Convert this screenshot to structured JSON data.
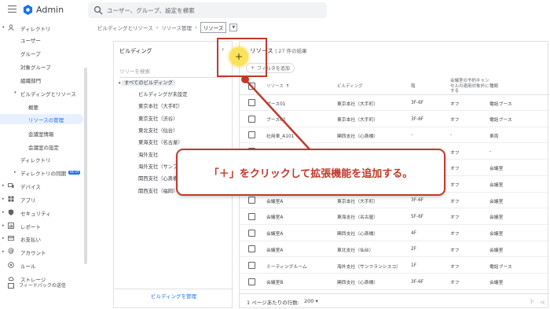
{
  "app": {
    "title": "Admin"
  },
  "search": {
    "placeholder": "ユーザー、グループ、設定を検索"
  },
  "sidebar": {
    "items": [
      {
        "label": "ディレクトリ",
        "icon": "person-icon"
      },
      {
        "label": "ユーザー"
      },
      {
        "label": "グループ"
      },
      {
        "label": "対象グループ"
      },
      {
        "label": "組織部門"
      },
      {
        "label": "ビルディングとリソース"
      },
      {
        "label": "概要"
      },
      {
        "label": "リソースの管理"
      },
      {
        "label": "会議室情報"
      },
      {
        "label": "会議室の設定"
      },
      {
        "label": "ディレクトリ"
      },
      {
        "label": "ディレクトリの同期",
        "badge": "BETA"
      },
      {
        "label": "デバイス",
        "icon": "devices-icon"
      },
      {
        "label": "アプリ",
        "icon": "apps-icon"
      },
      {
        "label": "セキュリティ",
        "icon": "shield-icon"
      },
      {
        "label": "レポート",
        "icon": "bar-chart-icon"
      },
      {
        "label": "お支払い",
        "icon": "credit-card-icon"
      },
      {
        "label": "アカウント",
        "icon": "at-icon"
      },
      {
        "label": "ルール",
        "icon": "rule-icon"
      },
      {
        "label": "ストレージ",
        "icon": "cloud-icon"
      }
    ],
    "feedback": "フィードバックの送信"
  },
  "breadcrumb": {
    "items": [
      "ビルディングとリソース",
      "リソース管理"
    ],
    "current": "リソース"
  },
  "buildings": {
    "title": "ビルディング",
    "search_placeholder": "ツリーを検索",
    "root": "すべてのビルディング",
    "items": [
      "ビルディングが未設定",
      "東京本社（大手町）",
      "東京支社（渋谷）",
      "東北支社（仙台）",
      "東海支社（名古屋）",
      "海外支社",
      "海外支社（サンフ",
      "関西支社（心斎橋",
      "関西支社（福岡）"
    ],
    "manage_link": "ビルディングを管理"
  },
  "resources": {
    "title": "リソース",
    "count": "27 件の結果",
    "filter_label": "フィルタを追加",
    "columns": [
      "リソース",
      "ビルディング",
      "階",
      "会議室の予約キャンセルの適用対象外にする",
      "種類"
    ],
    "rows": [
      [
        "ブース01",
        "東京本社（大手町）",
        "3F-6F",
        "オフ",
        "電話ブース"
      ],
      [
        "ブース02",
        "東京本社（大手町）",
        "3F-6F",
        "オフ",
        "電話ブース"
      ],
      [
        "社用車_A101",
        "関西支社（心斎橋）",
        "-",
        "-",
        "車両"
      ],
      [
        "",
        "",
        "",
        "オフ",
        "-"
      ],
      [
        "",
        "",
        "",
        "オフ",
        "会議室"
      ],
      [
        "",
        "",
        "",
        "オフ",
        "会議室"
      ],
      [
        "会議室A",
        "東京本社（大手町）",
        "3F-6F",
        "オフ",
        "会議室"
      ],
      [
        "会議室A",
        "東海支社（名古屋）",
        "5F-6F",
        "オフ",
        "会議室"
      ],
      [
        "会議室A",
        "関西支社（心斎橋）",
        "4F",
        "オフ",
        "会議室"
      ],
      [
        "会議室A",
        "東北支社（仙台）",
        "2F",
        "オフ",
        "会議室"
      ],
      [
        "ミーティングルーム",
        "海外支社（サンフランシスコ）",
        "1F",
        "オフ",
        "電話ブース"
      ],
      [
        "会議室B",
        "関西支社（心斎橋）",
        "3F-6F",
        "オフ",
        "会議室"
      ]
    ],
    "pager": {
      "label": "1 ページあたりの行数:",
      "size": "200",
      "next": "ペー"
    }
  },
  "annotation": {
    "add_button": "+",
    "callout": "「＋」をクリックして拡張機能を追加する。",
    "highlight_color": "#c0392b",
    "add_circle_color": "#fbe25b"
  }
}
